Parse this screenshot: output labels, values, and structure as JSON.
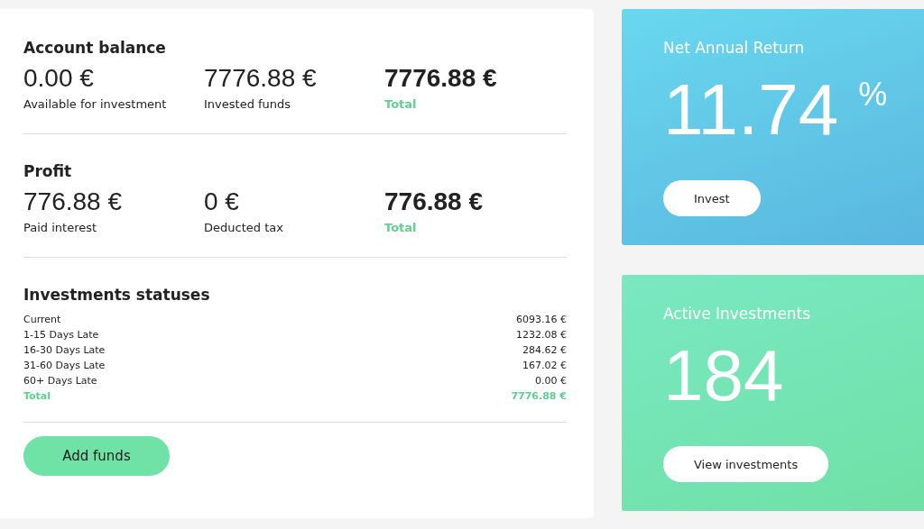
{
  "sections": [
    {
      "title": "Account balance",
      "figures": [
        {
          "value": "0.00 €",
          "label": "Available for investment",
          "kind": "plain"
        },
        {
          "value": "7776.88 €",
          "label": "Invested funds",
          "kind": "plain"
        },
        {
          "value": "7776.88 €",
          "label": "Total",
          "kind": "total"
        }
      ]
    },
    {
      "title": "Profit",
      "figures": [
        {
          "value": "776.88 €",
          "label": "Paid interest",
          "kind": "plain"
        },
        {
          "value": "0 €",
          "label": "Deducted tax",
          "kind": "plain"
        },
        {
          "value": "776.88 €",
          "label": "Total",
          "kind": "total"
        }
      ]
    }
  ],
  "statuses": {
    "title": "Investments statuses",
    "rows": [
      {
        "label": "Current",
        "amount": "6093.16 €",
        "kind": "plain"
      },
      {
        "label": "1-15 Days Late",
        "amount": "1232.08 €",
        "kind": "plain"
      },
      {
        "label": "16-30 Days Late",
        "amount": "284.62 €",
        "kind": "plain"
      },
      {
        "label": "31-60 Days Late",
        "amount": "167.02 €",
        "kind": "plain"
      },
      {
        "label": "60+ Days Late",
        "amount": "0.00 €",
        "kind": "plain"
      },
      {
        "label": "Total",
        "amount": "7776.88 €",
        "kind": "total"
      }
    ]
  },
  "add_button": "Add funds",
  "stat_cards": [
    {
      "title": "Net Annual Return",
      "value": "11.74",
      "unit": "%",
      "button": "Invest",
      "kind": "blue"
    },
    {
      "title": "Active Investments",
      "value": "184",
      "button": "View investments",
      "kind": "green"
    }
  ]
}
